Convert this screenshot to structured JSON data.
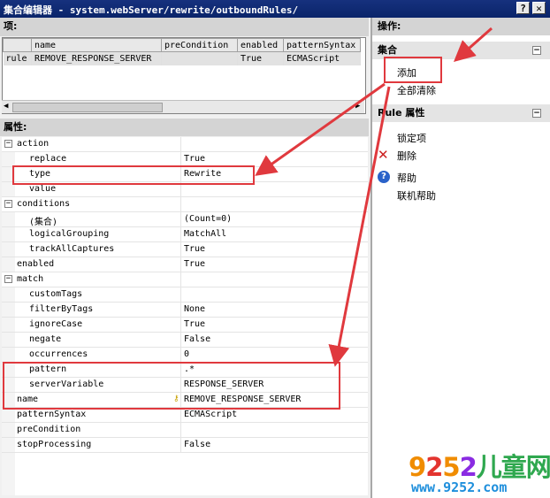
{
  "window": {
    "title": "集合编辑器 - system.webServer/rewrite/outboundRules/",
    "help_btn": "?",
    "close_btn": "✕"
  },
  "items_section": {
    "header": "项:",
    "columns": [
      "name",
      "preCondition",
      "enabled",
      "patternSyntax"
    ],
    "rows": [
      {
        "label": "rule",
        "name": "REMOVE_RESPONSE_SERVER",
        "preCondition": "",
        "enabled": "True",
        "patternSyntax": "ECMAScript"
      }
    ]
  },
  "properties_section": {
    "header": "属性:",
    "rows": [
      {
        "name": "action",
        "value": "",
        "category": true
      },
      {
        "name": "replace",
        "value": "True"
      },
      {
        "name": "type",
        "value": "Rewrite"
      },
      {
        "name": "value",
        "value": ""
      },
      {
        "name": "conditions",
        "value": "",
        "category": true
      },
      {
        "name": "(集合)",
        "value": "(Count=0)"
      },
      {
        "name": "logicalGrouping",
        "value": "MatchAll"
      },
      {
        "name": "trackAllCaptures",
        "value": "True"
      },
      {
        "name": "enabled",
        "value": "True",
        "top": true
      },
      {
        "name": "match",
        "value": "",
        "category": true
      },
      {
        "name": "customTags",
        "value": ""
      },
      {
        "name": "filterByTags",
        "value": "None"
      },
      {
        "name": "ignoreCase",
        "value": "True"
      },
      {
        "name": "negate",
        "value": "False"
      },
      {
        "name": "occurrences",
        "value": "0"
      },
      {
        "name": "pattern",
        "value": ".*"
      },
      {
        "name": "serverVariable",
        "value": "RESPONSE_SERVER"
      },
      {
        "name": "name",
        "value": "REMOVE_RESPONSE_SERVER",
        "top": true
      },
      {
        "name": "patternSyntax",
        "value": "ECMAScript",
        "top": true
      },
      {
        "name": "preCondition",
        "value": "",
        "top": true
      },
      {
        "name": "stopProcessing",
        "value": "False",
        "top": true
      }
    ]
  },
  "actions_panel": {
    "header": "操作:",
    "collection_group": {
      "title": "集合",
      "add": "添加",
      "clear_all": "全部清除"
    },
    "rule_group": {
      "title": "Rule 属性",
      "lock": "锁定项",
      "delete": "删除",
      "help": "帮助",
      "online_help": "联机帮助"
    }
  },
  "watermark": {
    "digits": "9252",
    "chinese": "儿童网",
    "url": "www.9252.com"
  },
  "colors": {
    "annotation_red": "#e0393e",
    "titlebar": "#0a246a",
    "delete_icon": "#cc2020",
    "help_icon": "#2a62c9"
  }
}
